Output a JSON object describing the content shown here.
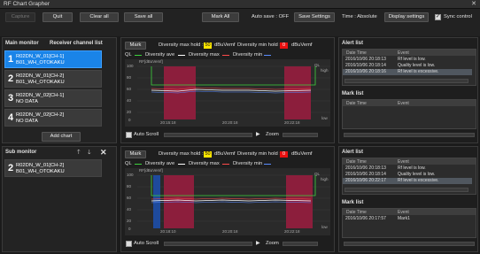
{
  "window": {
    "title": "RF Chart Grapher",
    "close": "✕"
  },
  "toolbar": {
    "capture": "Capture",
    "quit": "Quit",
    "clear_all": "Clear all",
    "save_all": "Save all",
    "mark_all": "Mark All",
    "auto_save": "Auto save : OFF",
    "save_settings": "Save Settings",
    "time_mode": "Time : Absolute",
    "display_settings": "Display settings",
    "sync_control": "Sync control"
  },
  "main_monitor": {
    "title": "Main monitor",
    "receiver_list": "Receiver channel list",
    "channels": [
      {
        "num": "1",
        "line1": "R02DN_W_01[CH-1]",
        "line2": "B01_WH_OTOKAKU"
      },
      {
        "num": "2",
        "line1": "R02DN_W_01[CH-2]",
        "line2": "B01_WH_OTOKAKU"
      },
      {
        "num": "3",
        "line1": "R02DN_W_02[CH-1]",
        "line2": "NO DATA"
      },
      {
        "num": "4",
        "line1": "R02DN_W_02[CH-2]",
        "line2": "NO DATA"
      }
    ],
    "add_chart": "Add chart"
  },
  "sub_monitor": {
    "title": "Sub monitor",
    "channels": [
      {
        "num": "2",
        "line1": "R02DN_W_01[CH-2]",
        "line2": "B01_WH_OTOKAKU"
      }
    ]
  },
  "chart_top": {
    "mark": "Mark",
    "div_max_label": "Diversity max hold :",
    "div_max_val": "50",
    "unit": "dBuVemf",
    "div_min_label": "Diversity min hold :",
    "div_min_val": "0",
    "legend": {
      "ql": "QL",
      "ave": "Diversity ave",
      "max": "Diversity max",
      "min": "Diversity min"
    },
    "ylabel": "RF[dBuVemf]",
    "yticks": [
      "100",
      "80",
      "60",
      "40",
      "20",
      "0"
    ],
    "xticks": [
      "20:15:18",
      "20:20:18",
      "20:22:18"
    ],
    "ql": "QL",
    "high": "high",
    "low": "low",
    "auto_scroll": "Auto Scroll",
    "zoom": "Zoom"
  },
  "chart_bottom": {
    "mark": "Mark",
    "div_max_label": "Diversity max hold :",
    "div_max_val": "50",
    "unit": "dBuVemf",
    "div_min_label": "Diversity min hold :",
    "div_min_val": "0",
    "legend": {
      "ql": "QL",
      "ave": "Diversity ave",
      "max": "Diversity max",
      "min": "Diversity min"
    },
    "ylabel": "RF[dBuVemf]",
    "yticks": [
      "100",
      "80",
      "60",
      "40",
      "20",
      "0"
    ],
    "xticks": [
      "20:18:10",
      "20:20:18",
      "20:22:18"
    ],
    "ql": "QL",
    "high": "high",
    "low": "low",
    "auto_scroll": "Auto Scroll",
    "zoom": "Zoom"
  },
  "alert_top": {
    "title": "Alert list",
    "col_time": "Date Time",
    "col_event": "Event",
    "rows": [
      {
        "time": "2016/10/06 20:18:13",
        "event": "Rf level is low."
      },
      {
        "time": "2016/10/06 20:18:14",
        "event": "Quality level is low."
      },
      {
        "time": "2016/10/06 20:18:16",
        "event": "Rf level is excessive."
      }
    ]
  },
  "mark_top": {
    "title": "Mark list",
    "col_time": "Date Time",
    "col_event": "Event",
    "rows": []
  },
  "alert_bottom": {
    "title": "Alert list",
    "col_time": "Date Time",
    "col_event": "Event",
    "rows": [
      {
        "time": "2016/10/06 20:18:13",
        "event": "Rf level is low."
      },
      {
        "time": "2016/10/06 20:18:14",
        "event": "Quality level is low."
      },
      {
        "time": "2016/10/06 20:22:17",
        "event": "Rf level is excessive."
      }
    ]
  },
  "mark_bottom": {
    "title": "Mark list",
    "col_time": "Date Time",
    "col_event": "Event",
    "rows": [
      {
        "time": "2016/10/06 20:17:57",
        "event": "Mark1"
      }
    ]
  },
  "colors": {
    "accent": "#1a84e8",
    "ql": "#3cd23c",
    "ave": "#ffffff",
    "max": "#ff4a4a",
    "min": "#5a8cff",
    "alarm_band": "#8c1e3c",
    "yellow": "#ffe600",
    "red": "#e81010"
  }
}
